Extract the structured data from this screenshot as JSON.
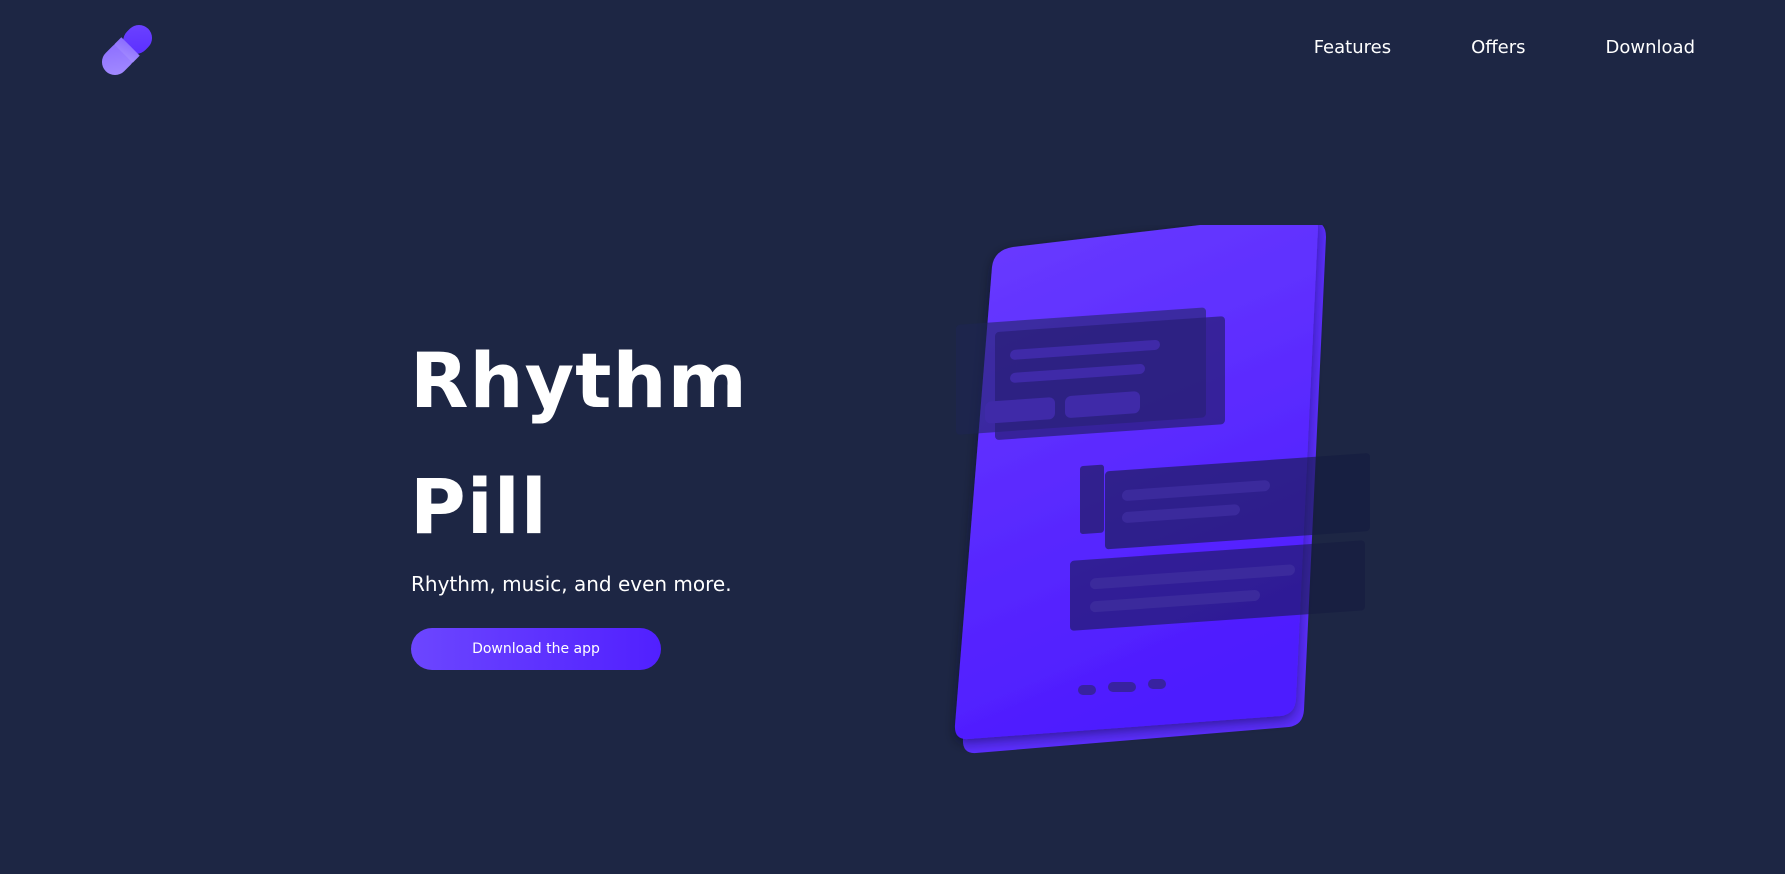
{
  "brand": {
    "logo_icon": "pill-icon",
    "colors": {
      "background": "#1d2644",
      "accent": "#5a2dff",
      "accent_light": "#9a80ff"
    }
  },
  "nav": {
    "items": [
      {
        "label": "Features"
      },
      {
        "label": "Offers"
      },
      {
        "label": "Download"
      }
    ]
  },
  "hero": {
    "title_line1": "Rhythm",
    "title_line2": "Pill",
    "subtitle": "Rhythm, music, and even more.",
    "cta_label": "Download the app"
  },
  "illustration": {
    "icon": "phone-app-illustration"
  }
}
